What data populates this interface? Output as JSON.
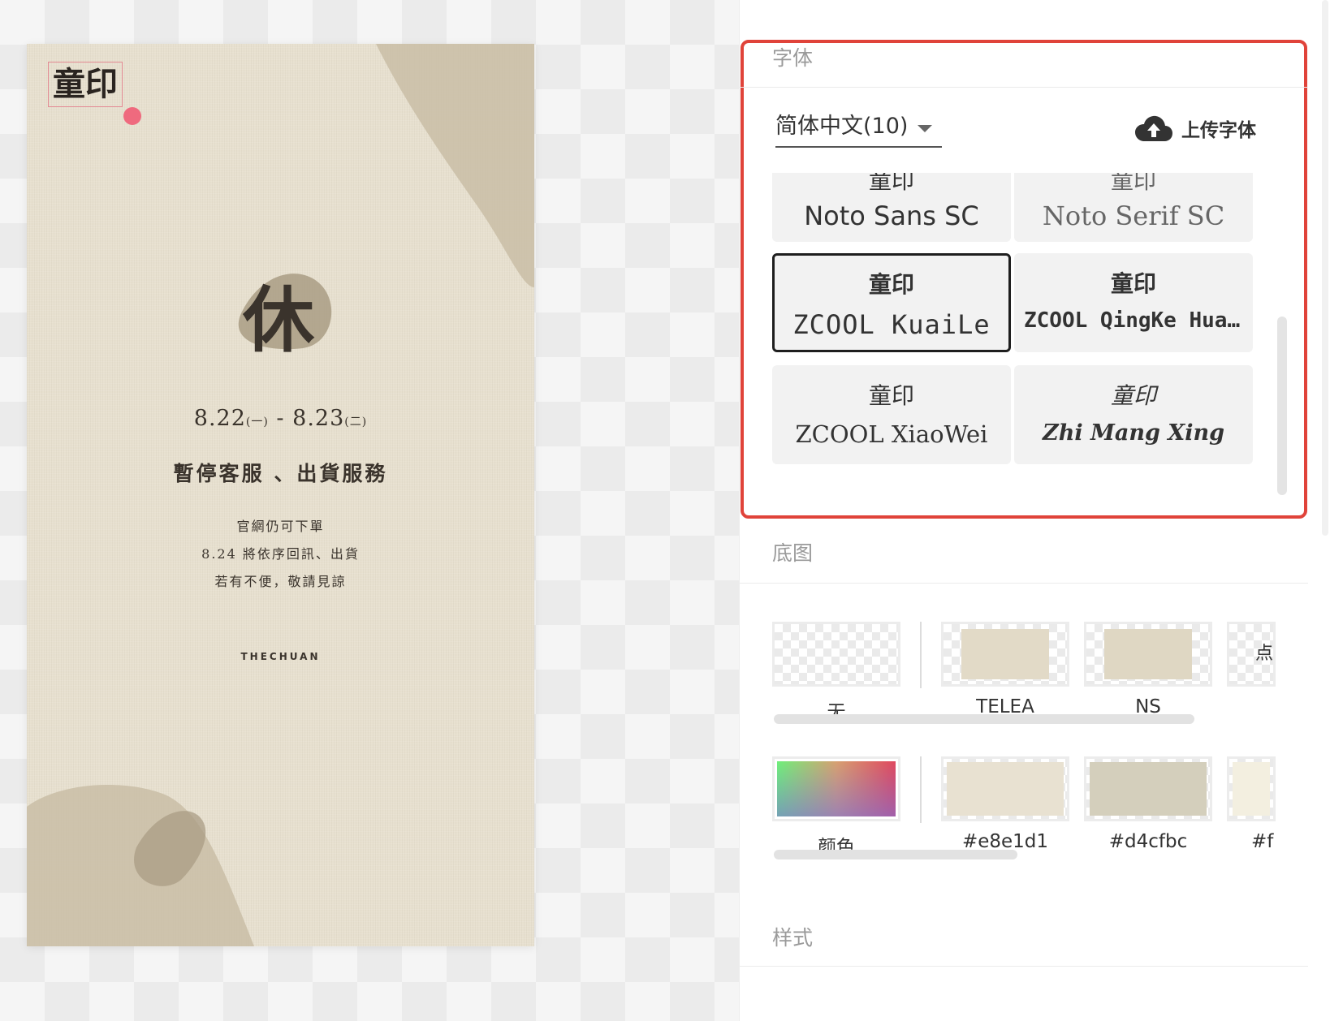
{
  "poster": {
    "logo_text": "童印",
    "rest_char": "休",
    "date_start": "8.22",
    "date_start_day": "(一)",
    "date_sep": " - ",
    "date_end": "8.23",
    "date_end_day": "(二)",
    "headline": "暫停客服 、出貨服務",
    "notes": [
      "官網仍可下單",
      "8.24 將依序回訊、出貨",
      "若有不便，敬請見諒"
    ],
    "brand": "THECHUAN",
    "colors": {
      "paper": "#e7e0cf",
      "blob": "#c9bda6",
      "ink": "#3a332c"
    }
  },
  "panel": {
    "font_section": {
      "title": "字体",
      "language_select": "简体中文(10)",
      "upload_label": "上传字体",
      "upload_icon": "cloud-upload-icon",
      "fonts": [
        {
          "sample": "童印",
          "name": "Noto Sans SC",
          "selected": false
        },
        {
          "sample": "童印",
          "name": "Noto Serif SC",
          "selected": false
        },
        {
          "sample": "童印",
          "name": "ZCOOL KuaiLe",
          "selected": true
        },
        {
          "sample": "童印",
          "name": "ZCOOL QingKe Huan···",
          "selected": false
        },
        {
          "sample": "童印",
          "name": "ZCOOL XiaoWei",
          "selected": false
        },
        {
          "sample": "童印",
          "name": "Zhi Mang Xing",
          "selected": false
        }
      ],
      "highlight_color": "#e0433a"
    },
    "background_section": {
      "title": "底图",
      "images": [
        {
          "label": "无"
        },
        {
          "label": "TELEA"
        },
        {
          "label": "NS"
        },
        {
          "label": "点"
        }
      ],
      "colors": [
        {
          "label": "颜色",
          "value": "gradient"
        },
        {
          "label": "#e8e1d1",
          "value": "#e8e1d1"
        },
        {
          "label": "#d4cfbc",
          "value": "#d4cfbc"
        },
        {
          "label": "#f",
          "value": "#f3efe0"
        }
      ]
    },
    "style_section": {
      "title": "样式"
    }
  }
}
